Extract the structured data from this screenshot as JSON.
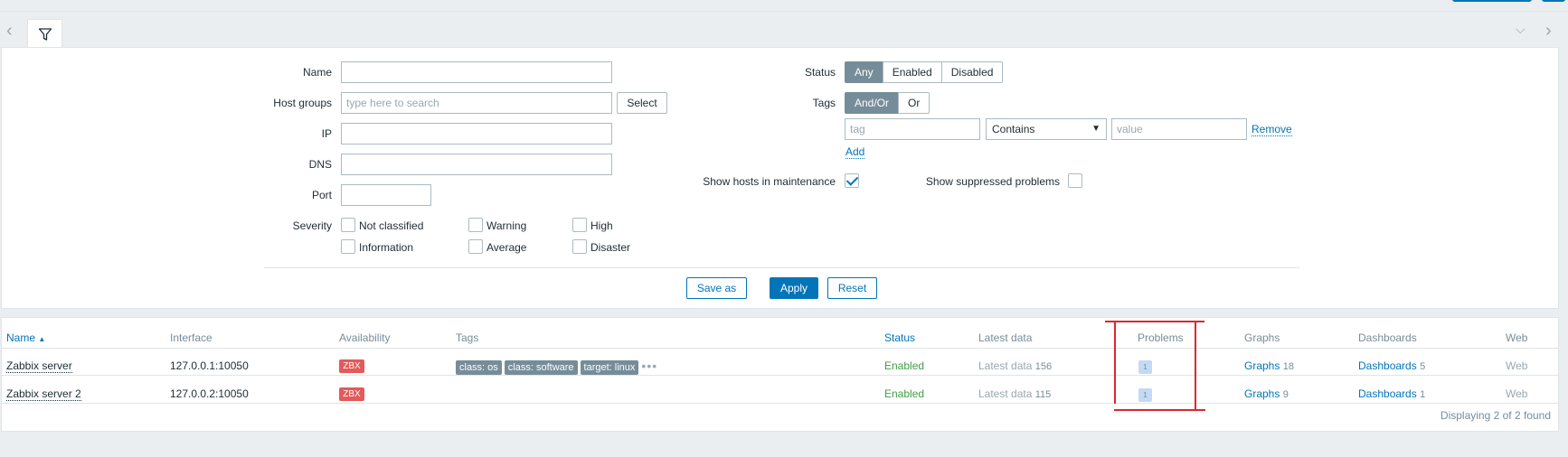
{
  "filter": {
    "name_label": "Name",
    "host_groups_label": "Host groups",
    "host_groups_placeholder": "type here to search",
    "select_label": "Select",
    "ip_label": "IP",
    "dns_label": "DNS",
    "port_label": "Port",
    "severity_label": "Severity",
    "severities": [
      "Not classified",
      "Warning",
      "High",
      "Information",
      "Average",
      "Disaster"
    ],
    "status_label": "Status",
    "status_options": [
      "Any",
      "Enabled",
      "Disabled"
    ],
    "status_selected": "Any",
    "tags_label": "Tags",
    "tags_options": [
      "And/Or",
      "Or"
    ],
    "tag_placeholder": "tag",
    "tag_operator": "Contains",
    "value_placeholder": "value",
    "remove_label": "Remove",
    "add_label": "Add",
    "maintenance_label": "Show hosts in maintenance",
    "maintenance_checked": true,
    "suppressed_label": "Show suppressed problems",
    "suppressed_checked": false,
    "save_as_label": "Save as",
    "apply_label": "Apply",
    "reset_label": "Reset"
  },
  "table": {
    "columns": [
      "Name",
      "Interface",
      "Availability",
      "Tags",
      "Status",
      "Latest data",
      "Problems",
      "Graphs",
      "Dashboards",
      "Web"
    ],
    "sort_indicator": "▲",
    "rows": [
      {
        "name": "Zabbix server",
        "interface": "127.0.0.1:10050",
        "availability": "ZBX",
        "tags": [
          "class: os",
          "class: software",
          "target: linux"
        ],
        "status": "Enabled",
        "latest_data": "Latest data",
        "latest_count": "156",
        "problems": "1",
        "graphs": "Graphs",
        "graphs_count": "18",
        "dashboards": "Dashboards",
        "dashboards_count": "5",
        "web": "Web"
      },
      {
        "name": "Zabbix server 2",
        "interface": "127.0.0.2:10050",
        "availability": "ZBX",
        "tags": [],
        "status": "Enabled",
        "latest_data": "Latest data",
        "latest_count": "115",
        "problems": "1",
        "graphs": "Graphs",
        "graphs_count": "9",
        "dashboards": "Dashboards",
        "dashboards_count": "1",
        "web": "Web"
      }
    ],
    "footer": "Displaying 2 of 2 found"
  },
  "colors": {
    "accent": "#0275b8",
    "enabled": "#429e47",
    "zbx_red": "#e45959",
    "highlight": "#d9282f"
  }
}
